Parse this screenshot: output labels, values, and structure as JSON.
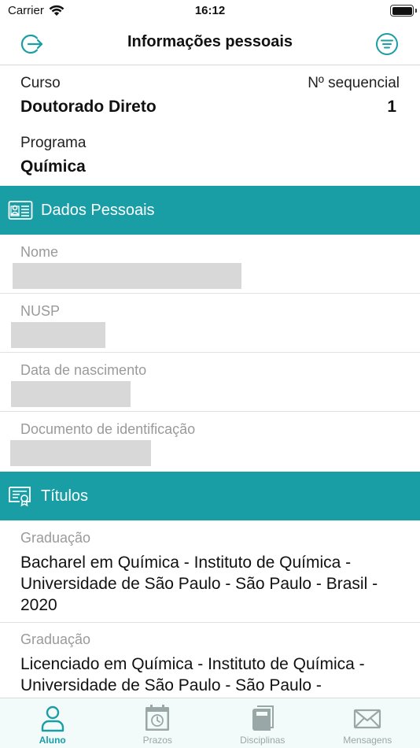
{
  "status": {
    "carrier": "Carrier",
    "time": "16:12"
  },
  "nav": {
    "title": "Informações pessoais"
  },
  "course": {
    "curso_label": "Curso",
    "curso_value": "Doutorado Direto",
    "seq_label": "Nº sequencial",
    "seq_value": "1",
    "programa_label": "Programa",
    "programa_value": "Química"
  },
  "dados": {
    "title": "Dados Pessoais",
    "fields": [
      {
        "label": "Nome"
      },
      {
        "label": "NUSP"
      },
      {
        "label": "Data de nascimento"
      },
      {
        "label": "Documento de identificação"
      }
    ]
  },
  "titulos": {
    "title": "Títulos",
    "items": [
      {
        "label": "Graduação",
        "text": "Bacharel em Química - Instituto de Química - Universidade de São Paulo - São Paulo - Brasil - 2020"
      },
      {
        "label": "Graduação",
        "text": "Licenciado em Química - Instituto de Química - Universidade de São Paulo - São Paulo -"
      }
    ]
  },
  "tabs": [
    {
      "label": "Aluno",
      "icon": "person-icon",
      "active": true
    },
    {
      "label": "Prazos",
      "icon": "calendar-icon",
      "active": false
    },
    {
      "label": "Disciplinas",
      "icon": "books-icon",
      "active": false
    },
    {
      "label": "Mensagens",
      "icon": "envelope-icon",
      "active": false
    }
  ],
  "colors": {
    "accent": "#1a9ea6",
    "inactive_tab": "#9aa7a7"
  }
}
